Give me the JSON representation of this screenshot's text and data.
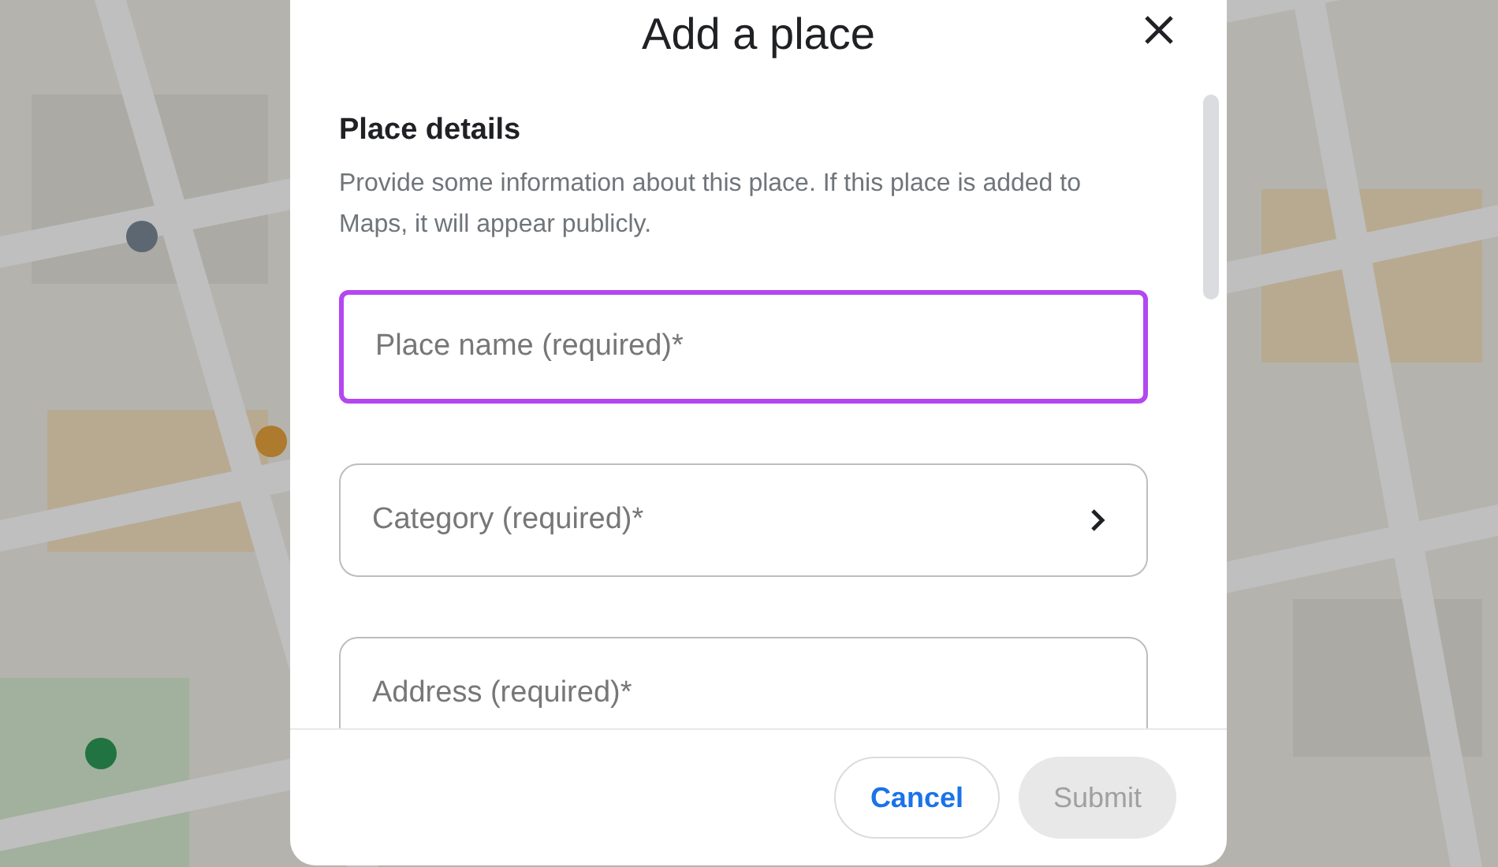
{
  "dialog": {
    "title": "Add a place",
    "section": {
      "heading": "Place details",
      "description": "Provide some information about this place. If this place is added to Maps, it will appear publicly."
    },
    "fields": [
      {
        "kind": "text",
        "placeholder": "Place name (required)*",
        "focused": true
      },
      {
        "kind": "select",
        "placeholder": "Category (required)*",
        "focused": false
      },
      {
        "kind": "text",
        "placeholder": "Address (required)*",
        "focused": false
      }
    ],
    "buttons": [
      {
        "label": "Cancel",
        "disabled": false
      },
      {
        "label": "Submit",
        "disabled": true
      }
    ]
  }
}
